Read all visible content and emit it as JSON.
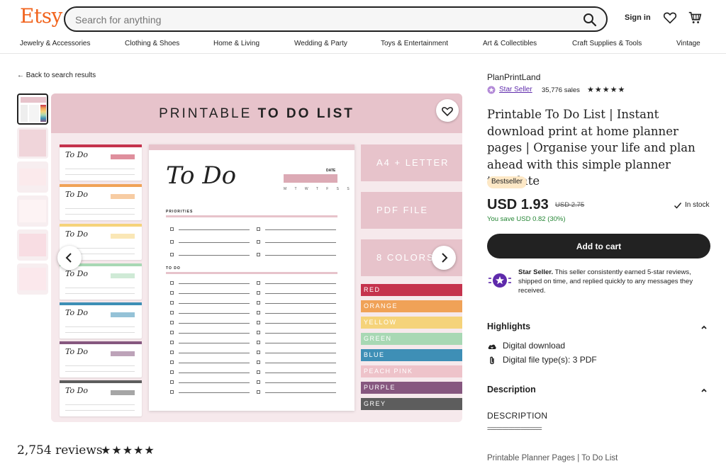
{
  "header": {
    "logo": "Etsy",
    "search_placeholder": "Search for anything",
    "signin_label": "Sign in"
  },
  "nav": {
    "categories": [
      "Jewelry & Accessories",
      "Clothing & Shoes",
      "Home & Living",
      "Wedding & Party",
      "Toys & Entertainment",
      "Art & Collectibles",
      "Craft Supplies & Tools",
      "Vintage"
    ]
  },
  "back_link": "Back to search results",
  "gallery": {
    "banner_light": "PRINTABLE ",
    "banner_bold": "TO DO LIST",
    "sheet": {
      "title": "To Do",
      "date_label": "DATE",
      "days": "M T W T F S S",
      "section_priorities": "PRIORITIES",
      "section_todo": "TO DO"
    },
    "mini_title": "To Do",
    "features": [
      "A4 + LETTER",
      "PDF FILE",
      "8 COLORS"
    ],
    "colors": [
      {
        "label": "RED",
        "color": "#c5334d"
      },
      {
        "label": "ORANGE",
        "color": "#f0a257"
      },
      {
        "label": "YELLOW",
        "color": "#f5d37a"
      },
      {
        "label": "GREEN",
        "color": "#a8d8b4"
      },
      {
        "label": "BLUE",
        "color": "#3e8fb6"
      },
      {
        "label": "PEACH PINK",
        "color": "#eec3ca"
      },
      {
        "label": "PURPLE",
        "color": "#86577f"
      },
      {
        "label": "GREY",
        "color": "#5d5d5d"
      }
    ]
  },
  "reviews": {
    "count_text": "2,754 reviews",
    "stars": "★★★★★"
  },
  "shop": {
    "name": "PlanPrintLand",
    "star_seller_label": "Star Seller",
    "sales": "35,776 sales",
    "stars": "★★★★★"
  },
  "listing": {
    "title": "Printable To Do List | Instant download print at home planner pages | Organise your life and plan ahead with this simple planner template",
    "badge": "Bestseller",
    "price": "USD 1.93",
    "old_price": "USD 2.75",
    "stock": "In stock",
    "savings": "You save USD 0.82 (30%)",
    "cart_label": "Add to cart",
    "star_seller_bold": "Star Seller.",
    "star_seller_text": " This seller consistently earned 5-star reviews, shipped on time, and replied quickly to any messages they received."
  },
  "highlights": {
    "heading": "Highlights",
    "items": [
      "Digital download",
      "Digital file type(s): 3 PDF"
    ]
  },
  "description": {
    "heading": "Description",
    "title": "DESCRIPTION",
    "rule": "==================",
    "first_line": "Printable Planner Pages | To Do List"
  },
  "colors": {
    "brand": "#f1641e",
    "banner_pink": "#e7c3cb",
    "star_seller_purple": "#5e2aab",
    "savings_green": "#258635",
    "bestseller_bg": "#fde8c6"
  }
}
